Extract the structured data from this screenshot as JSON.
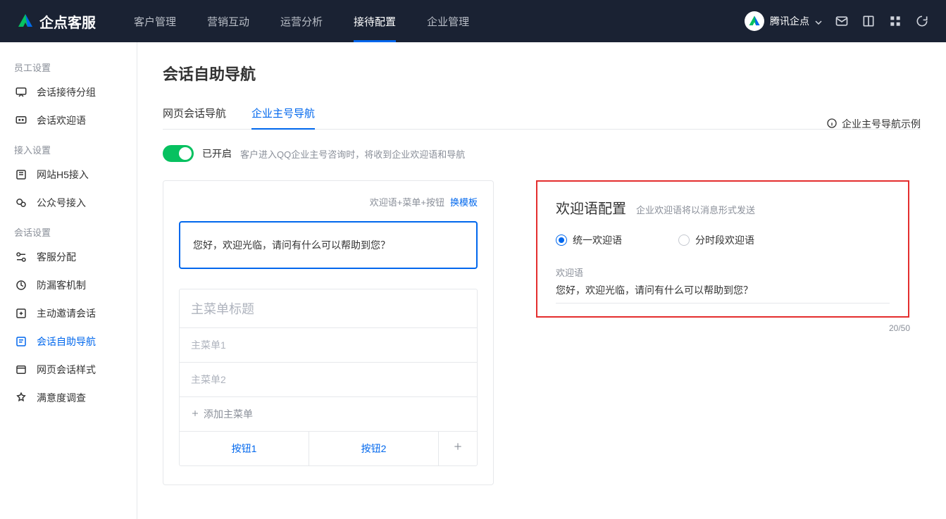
{
  "brand": {
    "name": "企点客服"
  },
  "nav": {
    "tabs": [
      {
        "label": "客户管理"
      },
      {
        "label": "营销互动"
      },
      {
        "label": "运营分析"
      },
      {
        "label": "接待配置",
        "active": true
      },
      {
        "label": "企业管理"
      }
    ],
    "tenant": "腾讯企点"
  },
  "sidebar": {
    "groups": [
      {
        "title": "员工设置",
        "items": [
          {
            "icon": "chat-group-icon",
            "label": "会话接待分组"
          },
          {
            "icon": "welcome-icon",
            "label": "会话欢迎语"
          }
        ]
      },
      {
        "title": "接入设置",
        "items": [
          {
            "icon": "h5-icon",
            "label": "网站H5接入"
          },
          {
            "icon": "wechat-icon",
            "label": "公众号接入"
          }
        ]
      },
      {
        "title": "会话设置",
        "items": [
          {
            "icon": "assign-icon",
            "label": "客服分配"
          },
          {
            "icon": "leak-icon",
            "label": "防漏客机制"
          },
          {
            "icon": "invite-icon",
            "label": "主动邀请会话"
          },
          {
            "icon": "selfnav-icon",
            "label": "会话自助导航",
            "active": true
          },
          {
            "icon": "style-icon",
            "label": "网页会话样式"
          },
          {
            "icon": "survey-icon",
            "label": "满意度调查"
          }
        ]
      }
    ]
  },
  "page": {
    "title": "会话自助导航",
    "subtabs": [
      {
        "label": "网页会话导航"
      },
      {
        "label": "企业主号导航",
        "active": true
      }
    ],
    "toggle": {
      "status": "已开启",
      "hint": "客户进入QQ企业主号咨询时，将收到企业欢迎语和导航"
    },
    "example_link": "企业主号导航示例"
  },
  "preview": {
    "crumb": "欢迎语+菜单+按钮",
    "change_template": "换模板",
    "welcome_text": "您好，欢迎光临，请问有什么可以帮助到您？",
    "menu_title_placeholder": "主菜单标题",
    "menu_items": [
      "主菜单1",
      "主菜单2"
    ],
    "add_menu": "添加主菜单",
    "buttons": [
      "按钮1",
      "按钮2"
    ]
  },
  "config": {
    "title": "欢迎语配置",
    "subtitle": "企业欢迎语将以消息形式发送",
    "radio1": "统一欢迎语",
    "radio2": "分时段欢迎语",
    "field_label": "欢迎语",
    "field_value": "您好，欢迎光临，请问有什么可以帮助到您？",
    "char_count": "20/50"
  }
}
